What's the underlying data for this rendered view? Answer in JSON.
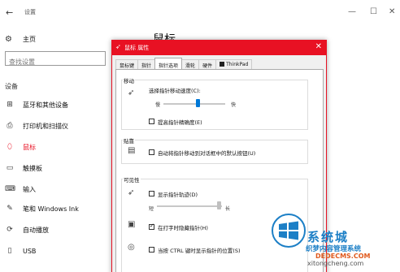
{
  "settings": {
    "window_title": "设置",
    "back_icon": "back-arrow-icon",
    "window_controls": [
      "—",
      "☐",
      "✕"
    ],
    "home_label": "主页",
    "search_placeholder": "查找设置",
    "section_label": "设备",
    "page_title": "鼠标",
    "nav": [
      {
        "label": "蓝牙和其他设备",
        "icon": "bluetooth-icon",
        "glyph": "⊞"
      },
      {
        "label": "打印机和扫描仪",
        "icon": "printer-icon",
        "glyph": "⎙"
      },
      {
        "label": "鼠标",
        "icon": "mouse-icon",
        "glyph": "⬯"
      },
      {
        "label": "触摸板",
        "icon": "touchpad-icon",
        "glyph": "▭"
      },
      {
        "label": "输入",
        "icon": "keyboard-icon",
        "glyph": "⌨"
      },
      {
        "label": "笔和 Windows Ink",
        "icon": "pen-icon",
        "glyph": "✎"
      },
      {
        "label": "自动播放",
        "icon": "autoplay-icon",
        "glyph": "⟳"
      },
      {
        "label": "USB",
        "icon": "usb-icon",
        "glyph": "▯"
      }
    ],
    "accent_color": "#e81123"
  },
  "dialog": {
    "title": "鼠标 属性",
    "tabs": [
      "鼠标键",
      "指针",
      "指针选项",
      "滑轮",
      "硬件",
      "ThinkPad"
    ],
    "active_tab": "指针选项",
    "motion": {
      "group_title": "移动",
      "speed_label": "选择指针移动速度(C):",
      "slow": "慢",
      "fast": "快",
      "speed_fraction": 0.55,
      "precision_label": "提高指针精确度(E)",
      "precision_checked": false
    },
    "snap": {
      "group_title": "贴靠",
      "label": "自动将指针移动到对话框中的默认按钮(U)",
      "checked": false
    },
    "visibility": {
      "group_title": "可见性",
      "trails_label": "显示指针轨迹(D)",
      "trails_checked": false,
      "short": "短",
      "long": "长",
      "trails_fraction": 0.95,
      "hide_typing_label": "在打字时隐藏指针(H)",
      "hide_typing_checked": true,
      "ctrl_label": "当按 CTRL 键时显示指针的位置(S)",
      "ctrl_checked": false
    }
  },
  "watermark": {
    "brand": "系统城",
    "line1": "织梦内容管理系统",
    "line2": "DEDECMS.COM",
    "line3": "xitongcheng.com"
  }
}
